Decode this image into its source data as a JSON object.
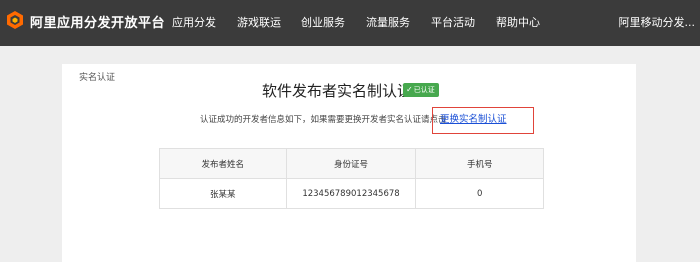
{
  "header": {
    "brand": "阿里应用分发开放平台",
    "nav": [
      "应用分发",
      "游戏联运",
      "创业服务",
      "流量服务",
      "平台活动",
      "帮助中心"
    ],
    "account": "阿里移动分发..."
  },
  "breadcrumb": "实名认证",
  "page": {
    "title": "软件发布者实名制认证",
    "badge": "已认证",
    "info": "认证成功的开发者信息如下，如果需要更换开发者实名认证请点击",
    "link": "更换实名制认证"
  },
  "table": {
    "headers": [
      "发布者姓名",
      "身份证号",
      "手机号"
    ],
    "rows": [
      [
        "张某某",
        "123456789012345678",
        "0"
      ]
    ]
  },
  "colors": {
    "topbar": "#3b3b3b",
    "link": "#1a4fd6",
    "badge": "#47a84e",
    "highlight": "#e0443a"
  }
}
